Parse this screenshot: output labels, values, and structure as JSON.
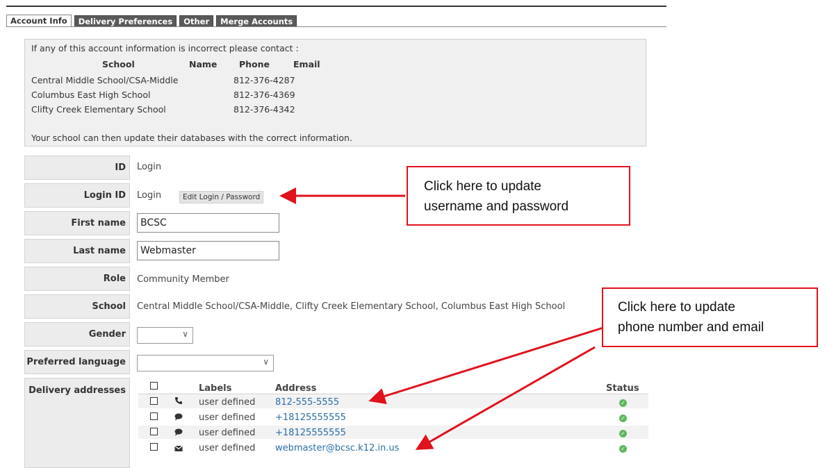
{
  "tabs": [
    "Account Info",
    "Delivery Preferences",
    "Other",
    "Merge Accounts"
  ],
  "info": {
    "intro": "If any of this account information is incorrect please contact :",
    "headers": {
      "school": "School",
      "name": "Name",
      "phone": "Phone",
      "email": "Email"
    },
    "contacts": [
      {
        "school": "Central Middle School/CSA-Middle",
        "phone": "812-376-4287"
      },
      {
        "school": "Columbus East High School",
        "phone": "812-376-4369"
      },
      {
        "school": "Clifty Creek Elementary School",
        "phone": "812-376-4342"
      }
    ],
    "footer": "Your school can then update their databases with the correct information."
  },
  "fields": {
    "id": {
      "label": "ID",
      "value": "Login"
    },
    "login_id": {
      "label": "Login ID",
      "value": "Login",
      "button": "Edit Login / Password"
    },
    "first_name": {
      "label": "First name",
      "value": "BCSC"
    },
    "last_name": {
      "label": "Last name",
      "value": "Webmaster"
    },
    "role": {
      "label": "Role",
      "value": "Community Member"
    },
    "school": {
      "label": "School",
      "value": "Central Middle School/CSA-Middle, Clifty Creek Elementary School, Columbus East High School"
    },
    "gender": {
      "label": "Gender",
      "value": ""
    },
    "language": {
      "label": "Preferred language",
      "value": ""
    },
    "delivery": {
      "label": "Delivery addresses"
    }
  },
  "delivery_table": {
    "headers": {
      "labels": "Labels",
      "address": "Address",
      "status": "Status"
    },
    "rows": [
      {
        "icon": "phone-icon",
        "label": "user defined",
        "address": "812-555-5555",
        "status": "ok"
      },
      {
        "icon": "sms-icon",
        "label": "user defined",
        "address": "+18125555555",
        "status": "ok"
      },
      {
        "icon": "sms-icon",
        "label": "user defined",
        "address": "+18125555555",
        "status": "ok"
      },
      {
        "icon": "email-icon",
        "label": "user defined",
        "address": "webmaster@bcsc.k12.in.us",
        "status": "ok"
      }
    ]
  },
  "callouts": {
    "login": [
      "Click here to update",
      "username and password"
    ],
    "contact": [
      "Click here to update",
      "phone number and email"
    ]
  },
  "colors": {
    "annotation": "#e0121c",
    "link": "#2a6fa8",
    "status_ok": "#5cb85c",
    "tab": "#5a5a5a"
  }
}
